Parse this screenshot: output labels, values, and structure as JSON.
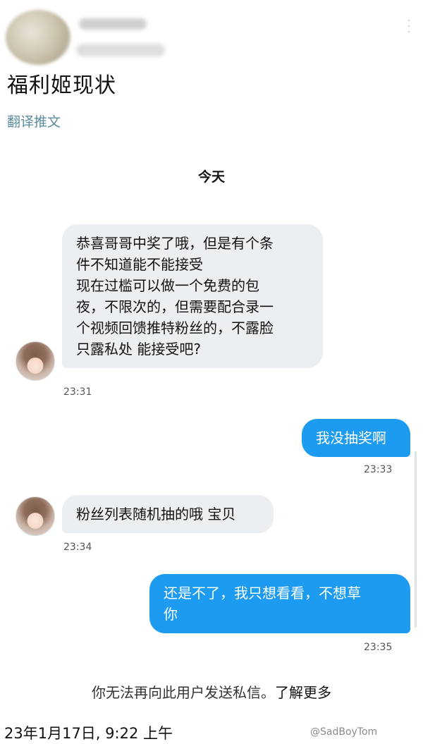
{
  "tweet": {
    "title": "福利姬现状",
    "translate_label": "翻译推文",
    "more_icon": "more-vertical-icon"
  },
  "dm": {
    "day_label": "今天",
    "messages": [
      {
        "direction": "in",
        "lines": [
          "恭喜哥哥中奖了哦，但是有个条",
          "件不知道能不能接受",
          "现在过槛可以做一个免费的包",
          "夜，不限次的，但需要配合录一",
          "个视频回馈推特粉丝的，不露脸",
          "只露私处 能接受吧?"
        ],
        "time": "23:31"
      },
      {
        "direction": "out",
        "lines": [
          "我没抽奖啊"
        ],
        "time": "23:33"
      },
      {
        "direction": "in",
        "lines": [
          "粉丝列表随机抽的哦 宝贝"
        ],
        "time": "23:34"
      },
      {
        "direction": "out",
        "lines": [
          "还是不了，我只想看看，不想草",
          "你"
        ],
        "time": "23:35"
      }
    ],
    "notice_text": "你无法再向此用户发送私信。",
    "notice_link": "了解更多",
    "footer_date": "23年1月17日, 9:22 上午",
    "watermark": "@SadBoyTom",
    "colors": {
      "outgoing_bubble": "#1d9bf0",
      "incoming_bubble": "#eceff1",
      "translate_link": "#5c8d9c"
    }
  }
}
